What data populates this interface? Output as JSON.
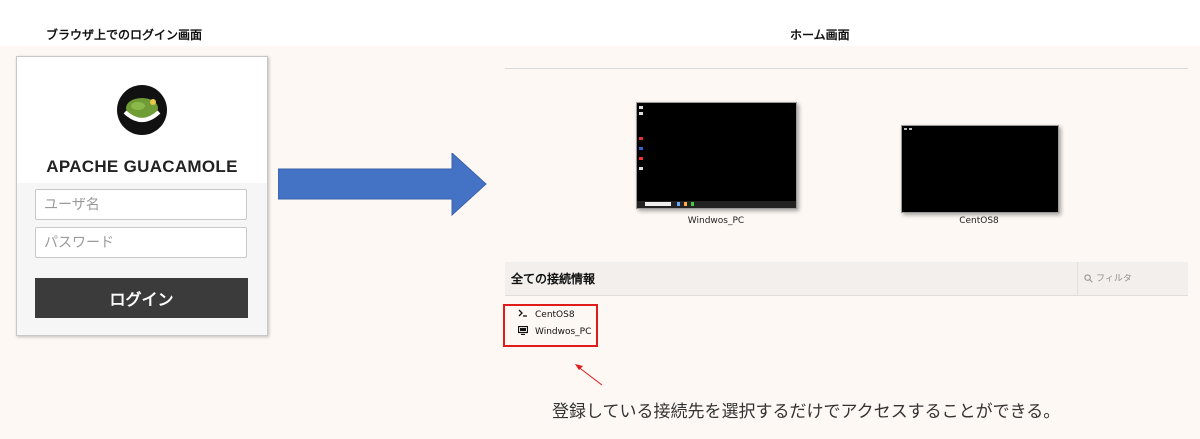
{
  "captions": {
    "login_screen": "ブラウザ上でのログイン画面",
    "home_screen": "ホーム画面"
  },
  "login": {
    "app_title": "APACHE GUACAMOLE",
    "username_placeholder": "ユーザ名",
    "password_placeholder": "パスワード",
    "login_button": "ログイン"
  },
  "home": {
    "recent_connections": [
      {
        "name": "Windwos_PC"
      },
      {
        "name": "CentOS8"
      }
    ],
    "section_title": "全ての接続情報",
    "filter_placeholder": "フィルタ",
    "connections": [
      {
        "name": "CentOS8",
        "icon": "terminal-icon"
      },
      {
        "name": "Windwos_PC",
        "icon": "monitor-icon"
      }
    ]
  },
  "annotation": {
    "note": "登録している接続先を選択するだけでアクセスすることができる。",
    "highlight_color": "#e01b1b"
  },
  "colors": {
    "arrow": "#4472c4",
    "login_button": "#3b3b3b"
  }
}
